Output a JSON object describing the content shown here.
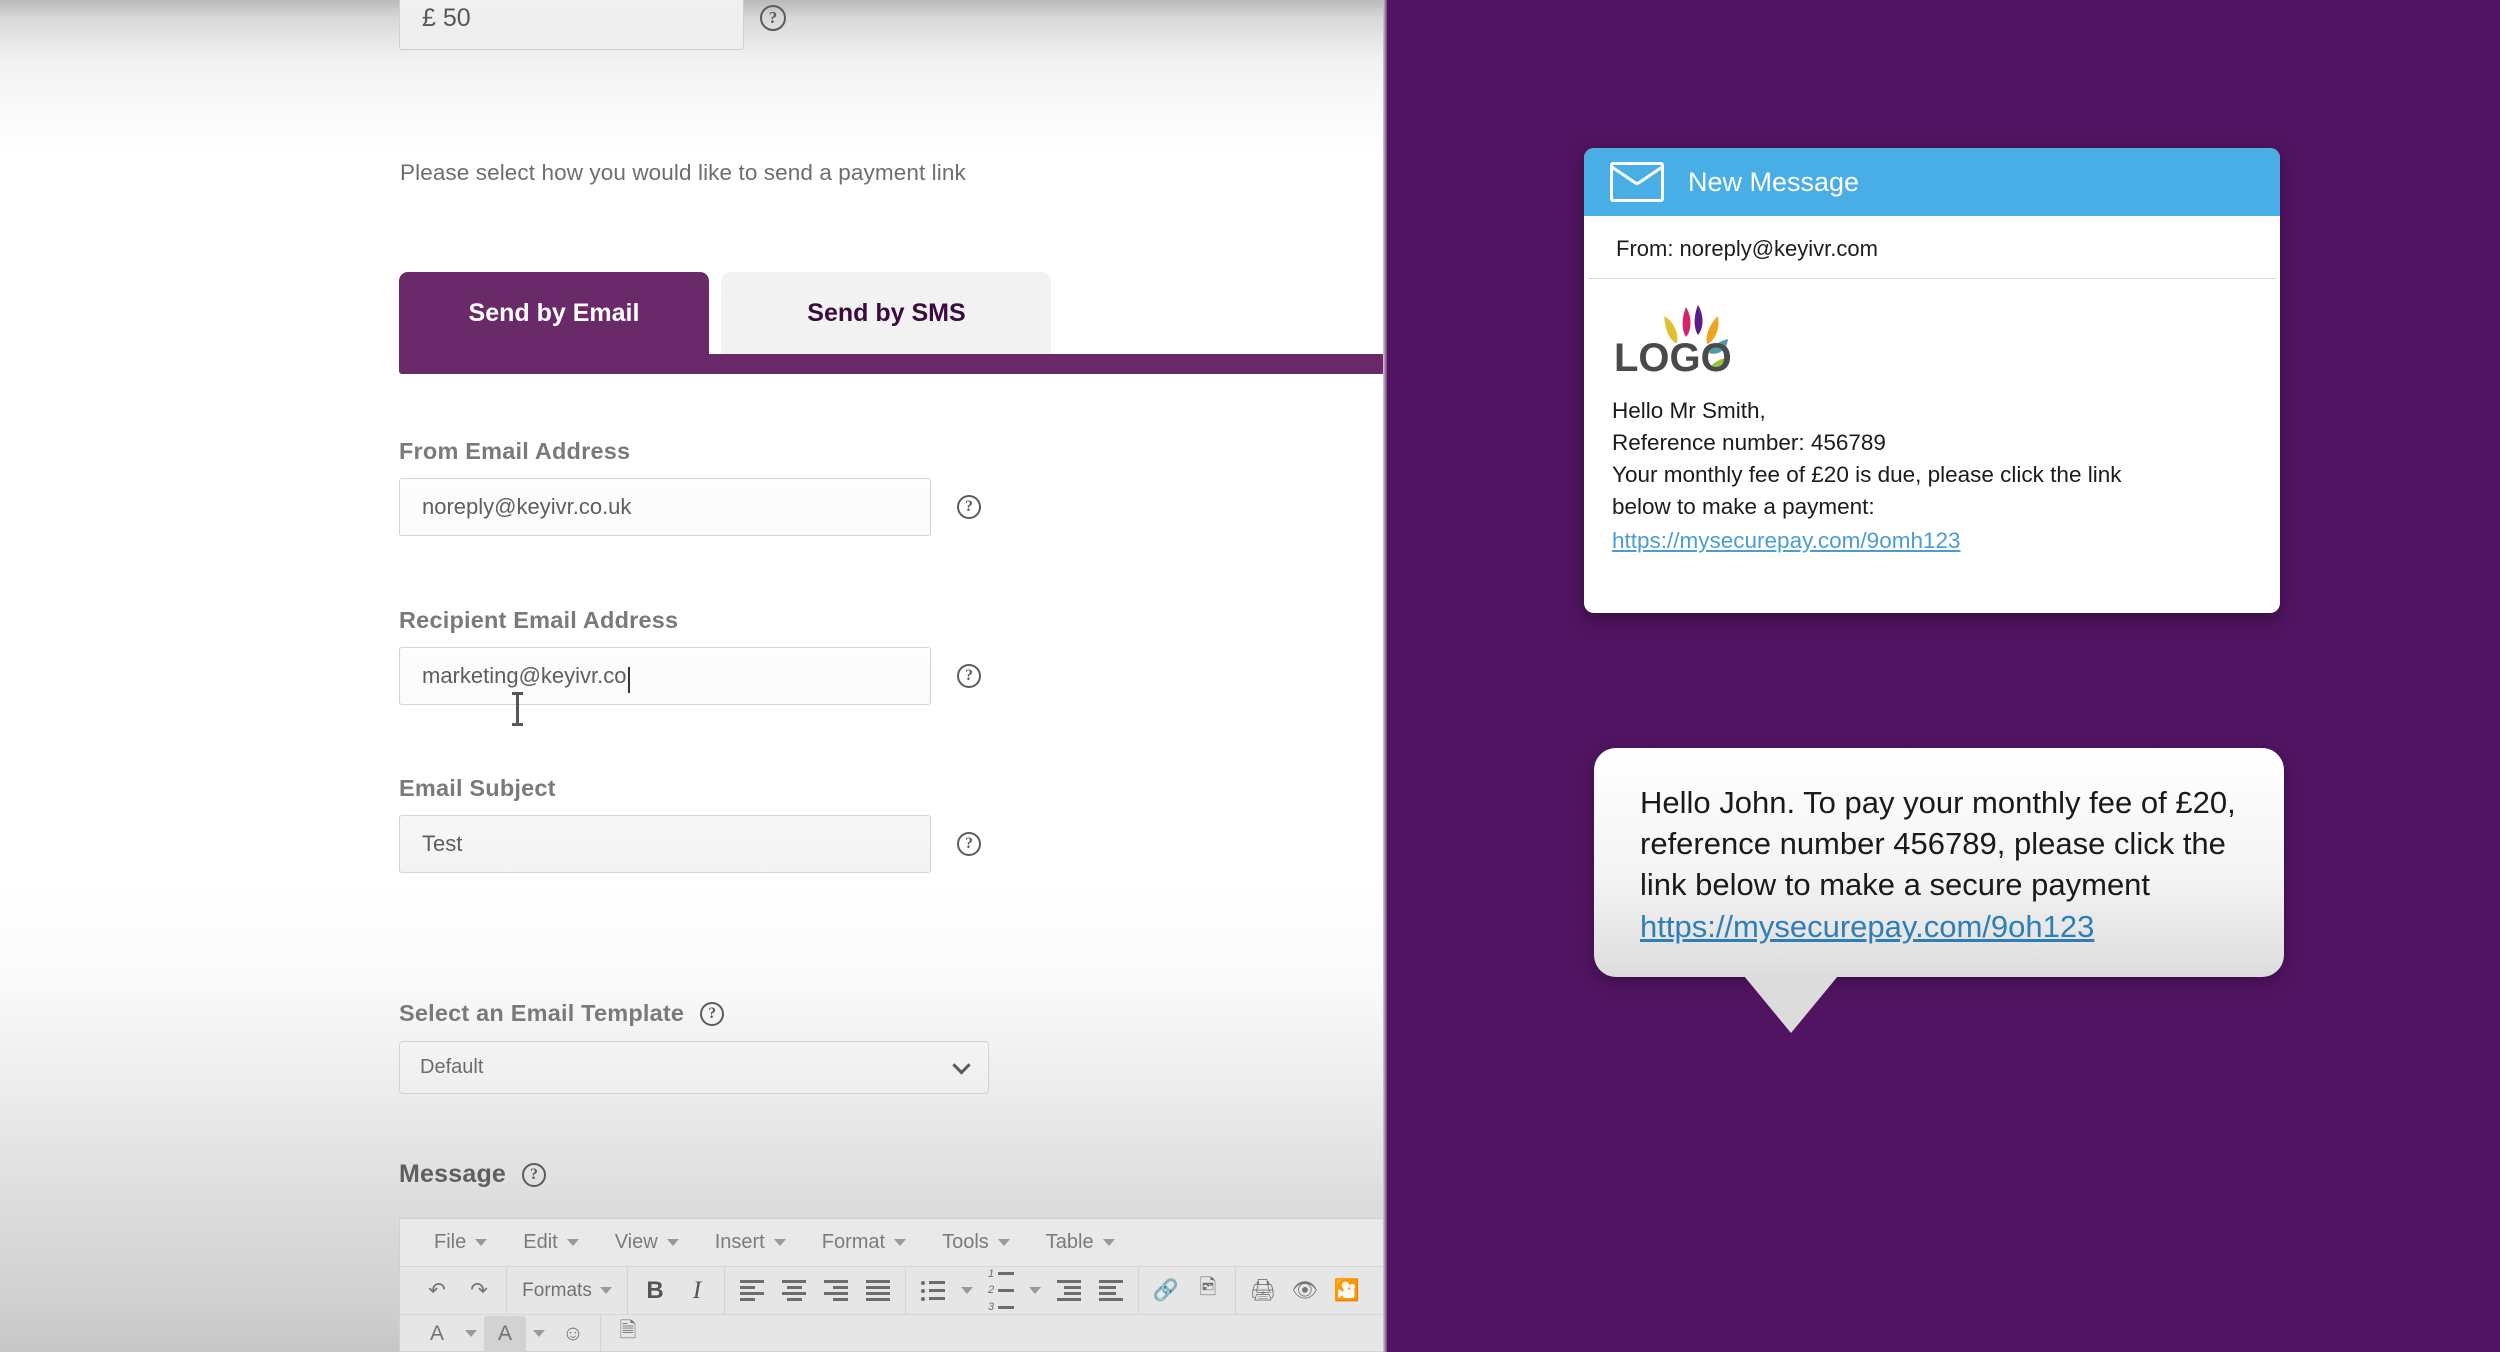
{
  "form": {
    "amount": {
      "value": "£ 50",
      "help_icon": "help-circle-icon"
    },
    "instruction": "Please select how you would like to send a payment link",
    "tabs": [
      {
        "label": "Send by Email",
        "active": true
      },
      {
        "label": "Send by SMS",
        "active": false
      }
    ],
    "fields": [
      {
        "label": "From Email Address",
        "value": "noreply@keyivr.co.uk"
      },
      {
        "label": "Recipient Email Address",
        "value": "marketing@keyivr.co"
      },
      {
        "label": "Email Subject",
        "value": "Test"
      }
    ],
    "template": {
      "label": "Select an Email Template",
      "selected": "Default",
      "options": [
        "Default"
      ]
    },
    "message": {
      "label": "Message"
    }
  },
  "editor": {
    "menu": [
      "File",
      "Edit",
      "View",
      "Insert",
      "Format",
      "Tools",
      "Table"
    ],
    "toolbar_row2": {
      "undo": "undo-icon",
      "redo": "redo-icon",
      "formats_label": "Formats",
      "bold": "B",
      "italic": "I",
      "align_left": "align-left-icon",
      "align_center": "align-center-icon",
      "align_right": "align-right-icon",
      "align_justify": "align-justify-icon",
      "bullet_list": "bullet-list-icon",
      "numbered_list": "numbered-list-icon",
      "outdent": "outdent-icon",
      "indent": "indent-icon",
      "link": "link-icon",
      "image": "image-icon",
      "print": "print-icon",
      "preview": "preview-icon",
      "media": "media-icon"
    },
    "toolbar_row3": {
      "text_color": "A",
      "background_color": "A",
      "emoticon": "emoticon-icon",
      "template": "template-icon"
    }
  },
  "preview": {
    "email": {
      "header_title": "New Message",
      "header_icon": "envelope-icon",
      "from": "From: noreply@keyivr.com",
      "logo_text": "LOGO",
      "lines": [
        "Hello Mr Smith,",
        "Reference number: 456789",
        "Your monthly fee of £20 is due, please click the link",
        "below to make a payment:"
      ],
      "link": "https://mysecurepay.com/9omh123"
    },
    "sms": {
      "text": "Hello John. To pay your monthly fee of £20, reference number 456789, please click the link below to make a secure payment",
      "link": "https://mysecurepay.com/9oh123"
    }
  },
  "colors": {
    "brand_purple": "#511462",
    "tab_purple": "#6a2a6a",
    "email_header_blue": "#49aee5",
    "link_blue": "#4b9cd3",
    "sms_link_blue": "#2e7fb8"
  }
}
